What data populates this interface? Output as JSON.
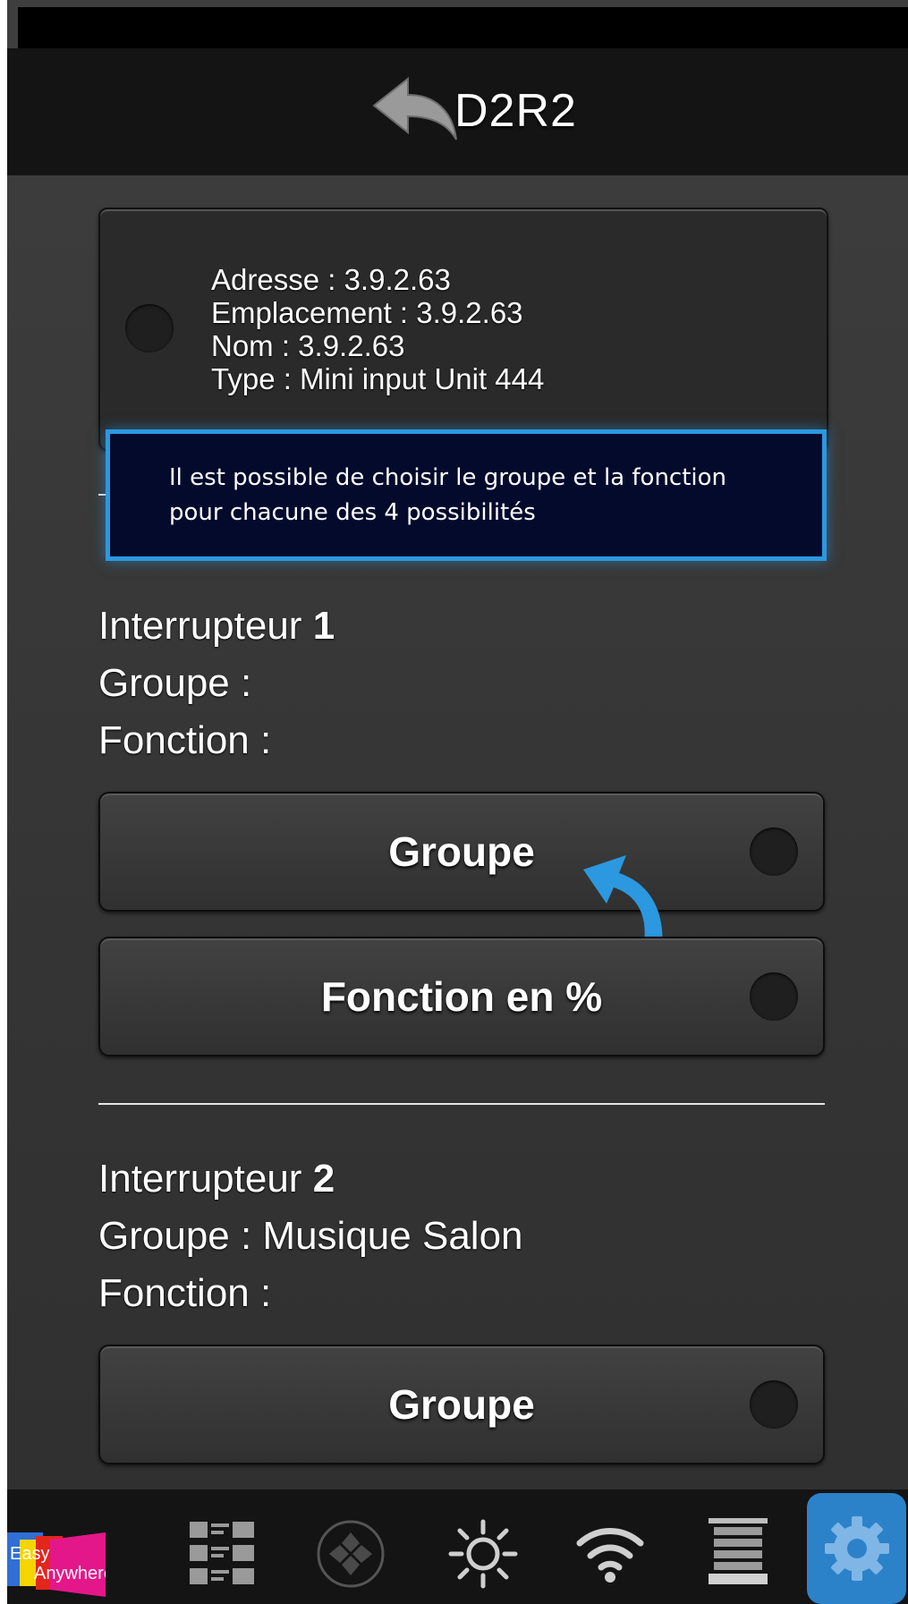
{
  "header": {
    "title": "D2R2"
  },
  "device": {
    "address": "Adresse : 3.9.2.63",
    "location": "Emplacement : 3.9.2.63",
    "name": "Nom : 3.9.2.63",
    "type": "Type : Mini input Unit 444"
  },
  "tooltip": {
    "text": "Il est possible de choisir le groupe et la fonction pour chacune des 4 possibilités"
  },
  "switches": [
    {
      "title": "Interrupteur ",
      "number": "1",
      "group": "Groupe :",
      "function": "Fonction :",
      "group_button": "Groupe",
      "function_button": "Fonction en %"
    },
    {
      "title": "Interrupteur ",
      "number": "2",
      "group": "Groupe : Musique Salon",
      "function": "Fonction :",
      "group_button": "Groupe"
    }
  ],
  "tabbar": {
    "logo": {
      "easy": "Easy",
      "anywhere": "Anywhere"
    },
    "tabs": [
      "grid-icon",
      "dpad-icon",
      "sun-icon",
      "wifi-icon",
      "blinds-icon",
      "gear-icon"
    ],
    "active_color": "#2c82c9"
  },
  "accent": "#2b98e0"
}
